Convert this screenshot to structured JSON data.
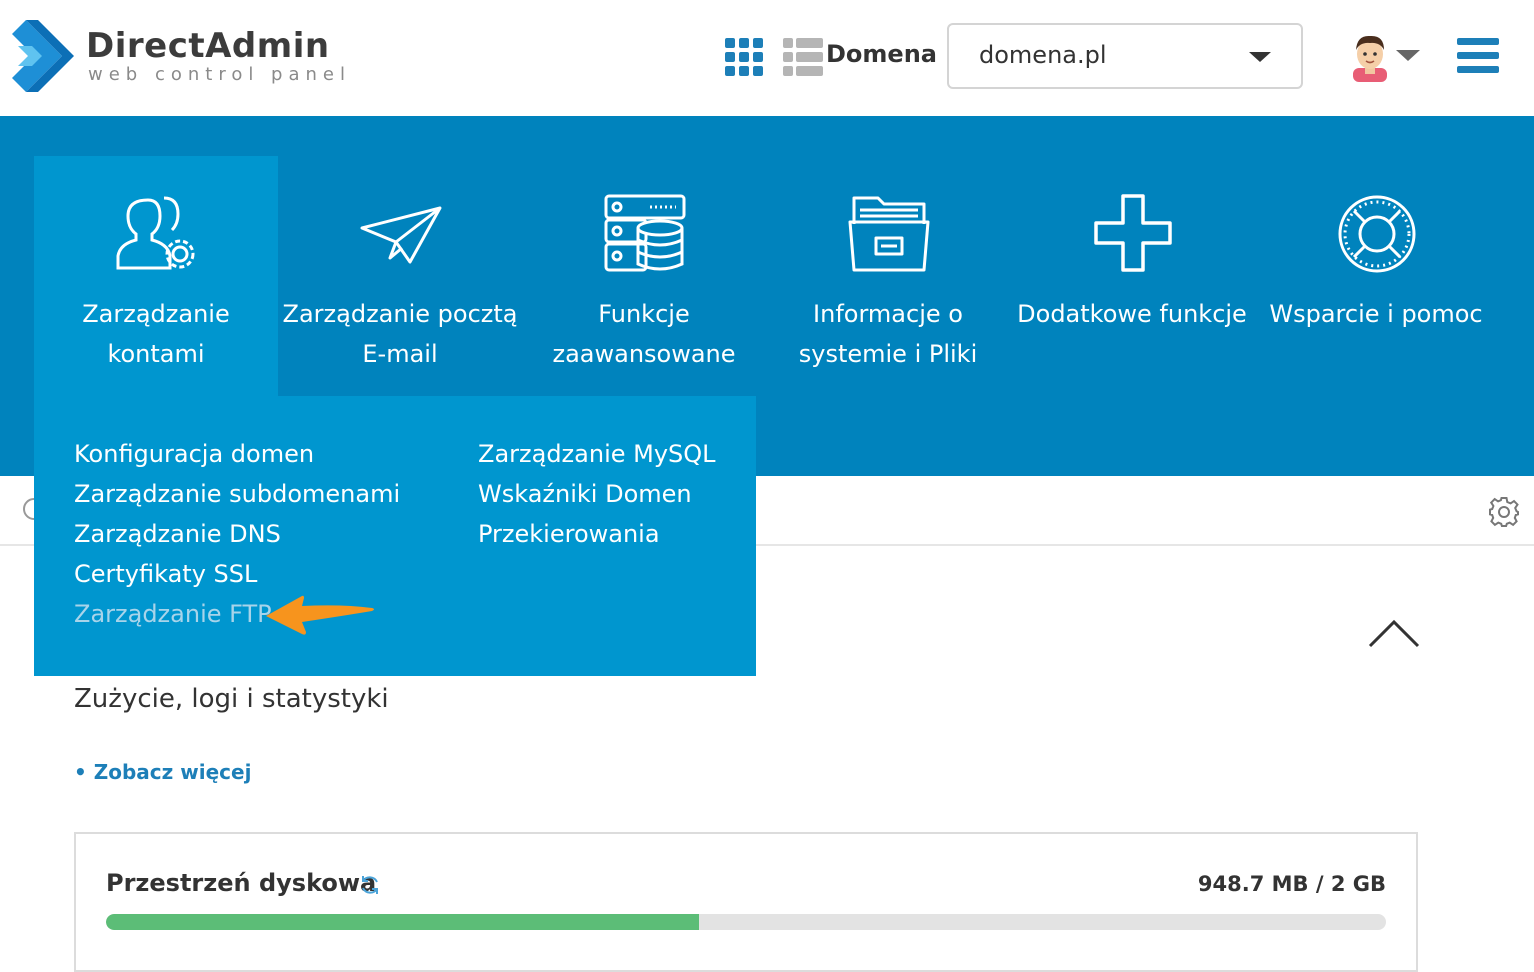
{
  "header": {
    "logo_name": "DirectAdmin",
    "logo_tagline": "web control panel",
    "domain_label": "Domena",
    "domain_select_value": "domena.pl",
    "icons": [
      "grid-icon",
      "list-icon",
      "avatar",
      "hamburger-menu-icon"
    ]
  },
  "nav": {
    "items": [
      {
        "label": "Zarządzanie kontami",
        "icon": "users-gear-icon",
        "active": true
      },
      {
        "label": "Zarządzanie pocztą E-mail",
        "icon": "paper-plane-icon"
      },
      {
        "label": "Funkcje zaawansowane",
        "icon": "server-database-icon"
      },
      {
        "label": "Informacje o systemie i Pliki",
        "icon": "folder-icon"
      },
      {
        "label": "Dodatkowe funkcje",
        "icon": "plus-icon"
      },
      {
        "label": "Wsparcie i pomoc",
        "icon": "lifebuoy-icon"
      }
    ]
  },
  "dropdown": {
    "left": [
      "Konfiguracja domen",
      "Zarządzanie subdomenami",
      "Zarządzanie DNS",
      "Certyfikaty SSL",
      "Zarządzanie FTP"
    ],
    "right": [
      "Zarządzanie MySQL",
      "Wskaźniki Domen",
      "Przekierowania"
    ]
  },
  "main": {
    "section_title": "Zużycie, logi i statystyki",
    "see_more": "• Zobacz więcej",
    "disk": {
      "title": "Przestrzeń dyskowa",
      "usage": "948.7 MB / 2 GB",
      "fraction": 0.4632
    }
  },
  "colors": {
    "brand_blue": "#0083bd",
    "active_blue": "#0096cf",
    "link_blue": "#1d7fb8",
    "progress_green": "#5cbd77",
    "arrow_orange": "#f7941d"
  }
}
